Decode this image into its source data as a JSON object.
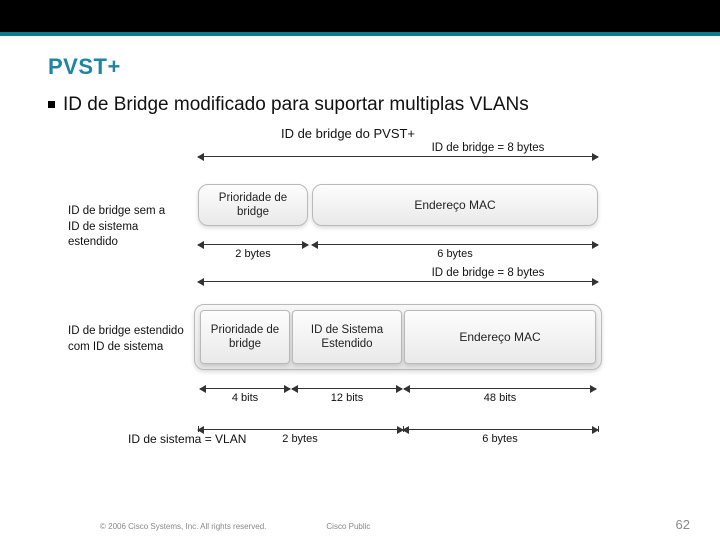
{
  "title": "PVST+",
  "bullet": "ID de Bridge modificado para suportar multiplas VLANs",
  "diagram": {
    "title": "ID de bridge do PVST+",
    "left_top": "ID de bridge sem a\nID de sistema estendido",
    "left_bot": "ID de bridge estendido\ncom ID de sistema",
    "top_total": "ID de bridge = 8 bytes",
    "top_cell_priority": "Prioridade de\nbridge",
    "top_cell_mac": "Endereço MAC",
    "top_dim_left": "2 bytes",
    "top_dim_right": "6 bytes",
    "mid_total": "ID de bridge = 8 bytes",
    "bot_cell_priority": "Prioridade de\nbridge",
    "bot_cell_sysid": "ID de Sistema\nEstendido",
    "bot_cell_mac": "Endereço MAC",
    "bot_dim_bits_a": "4 bits",
    "bot_dim_bits_b": "12 bits",
    "bot_dim_bits_c": "48 bits",
    "sys_eq": "ID de sistema = VLAN",
    "sys_dim_left": "2 bytes",
    "sys_dim_right": "6 bytes"
  },
  "footer": {
    "copyright": "© 2006 Cisco Systems, Inc. All rights reserved.",
    "classification": "Cisco Public",
    "page": "62"
  }
}
